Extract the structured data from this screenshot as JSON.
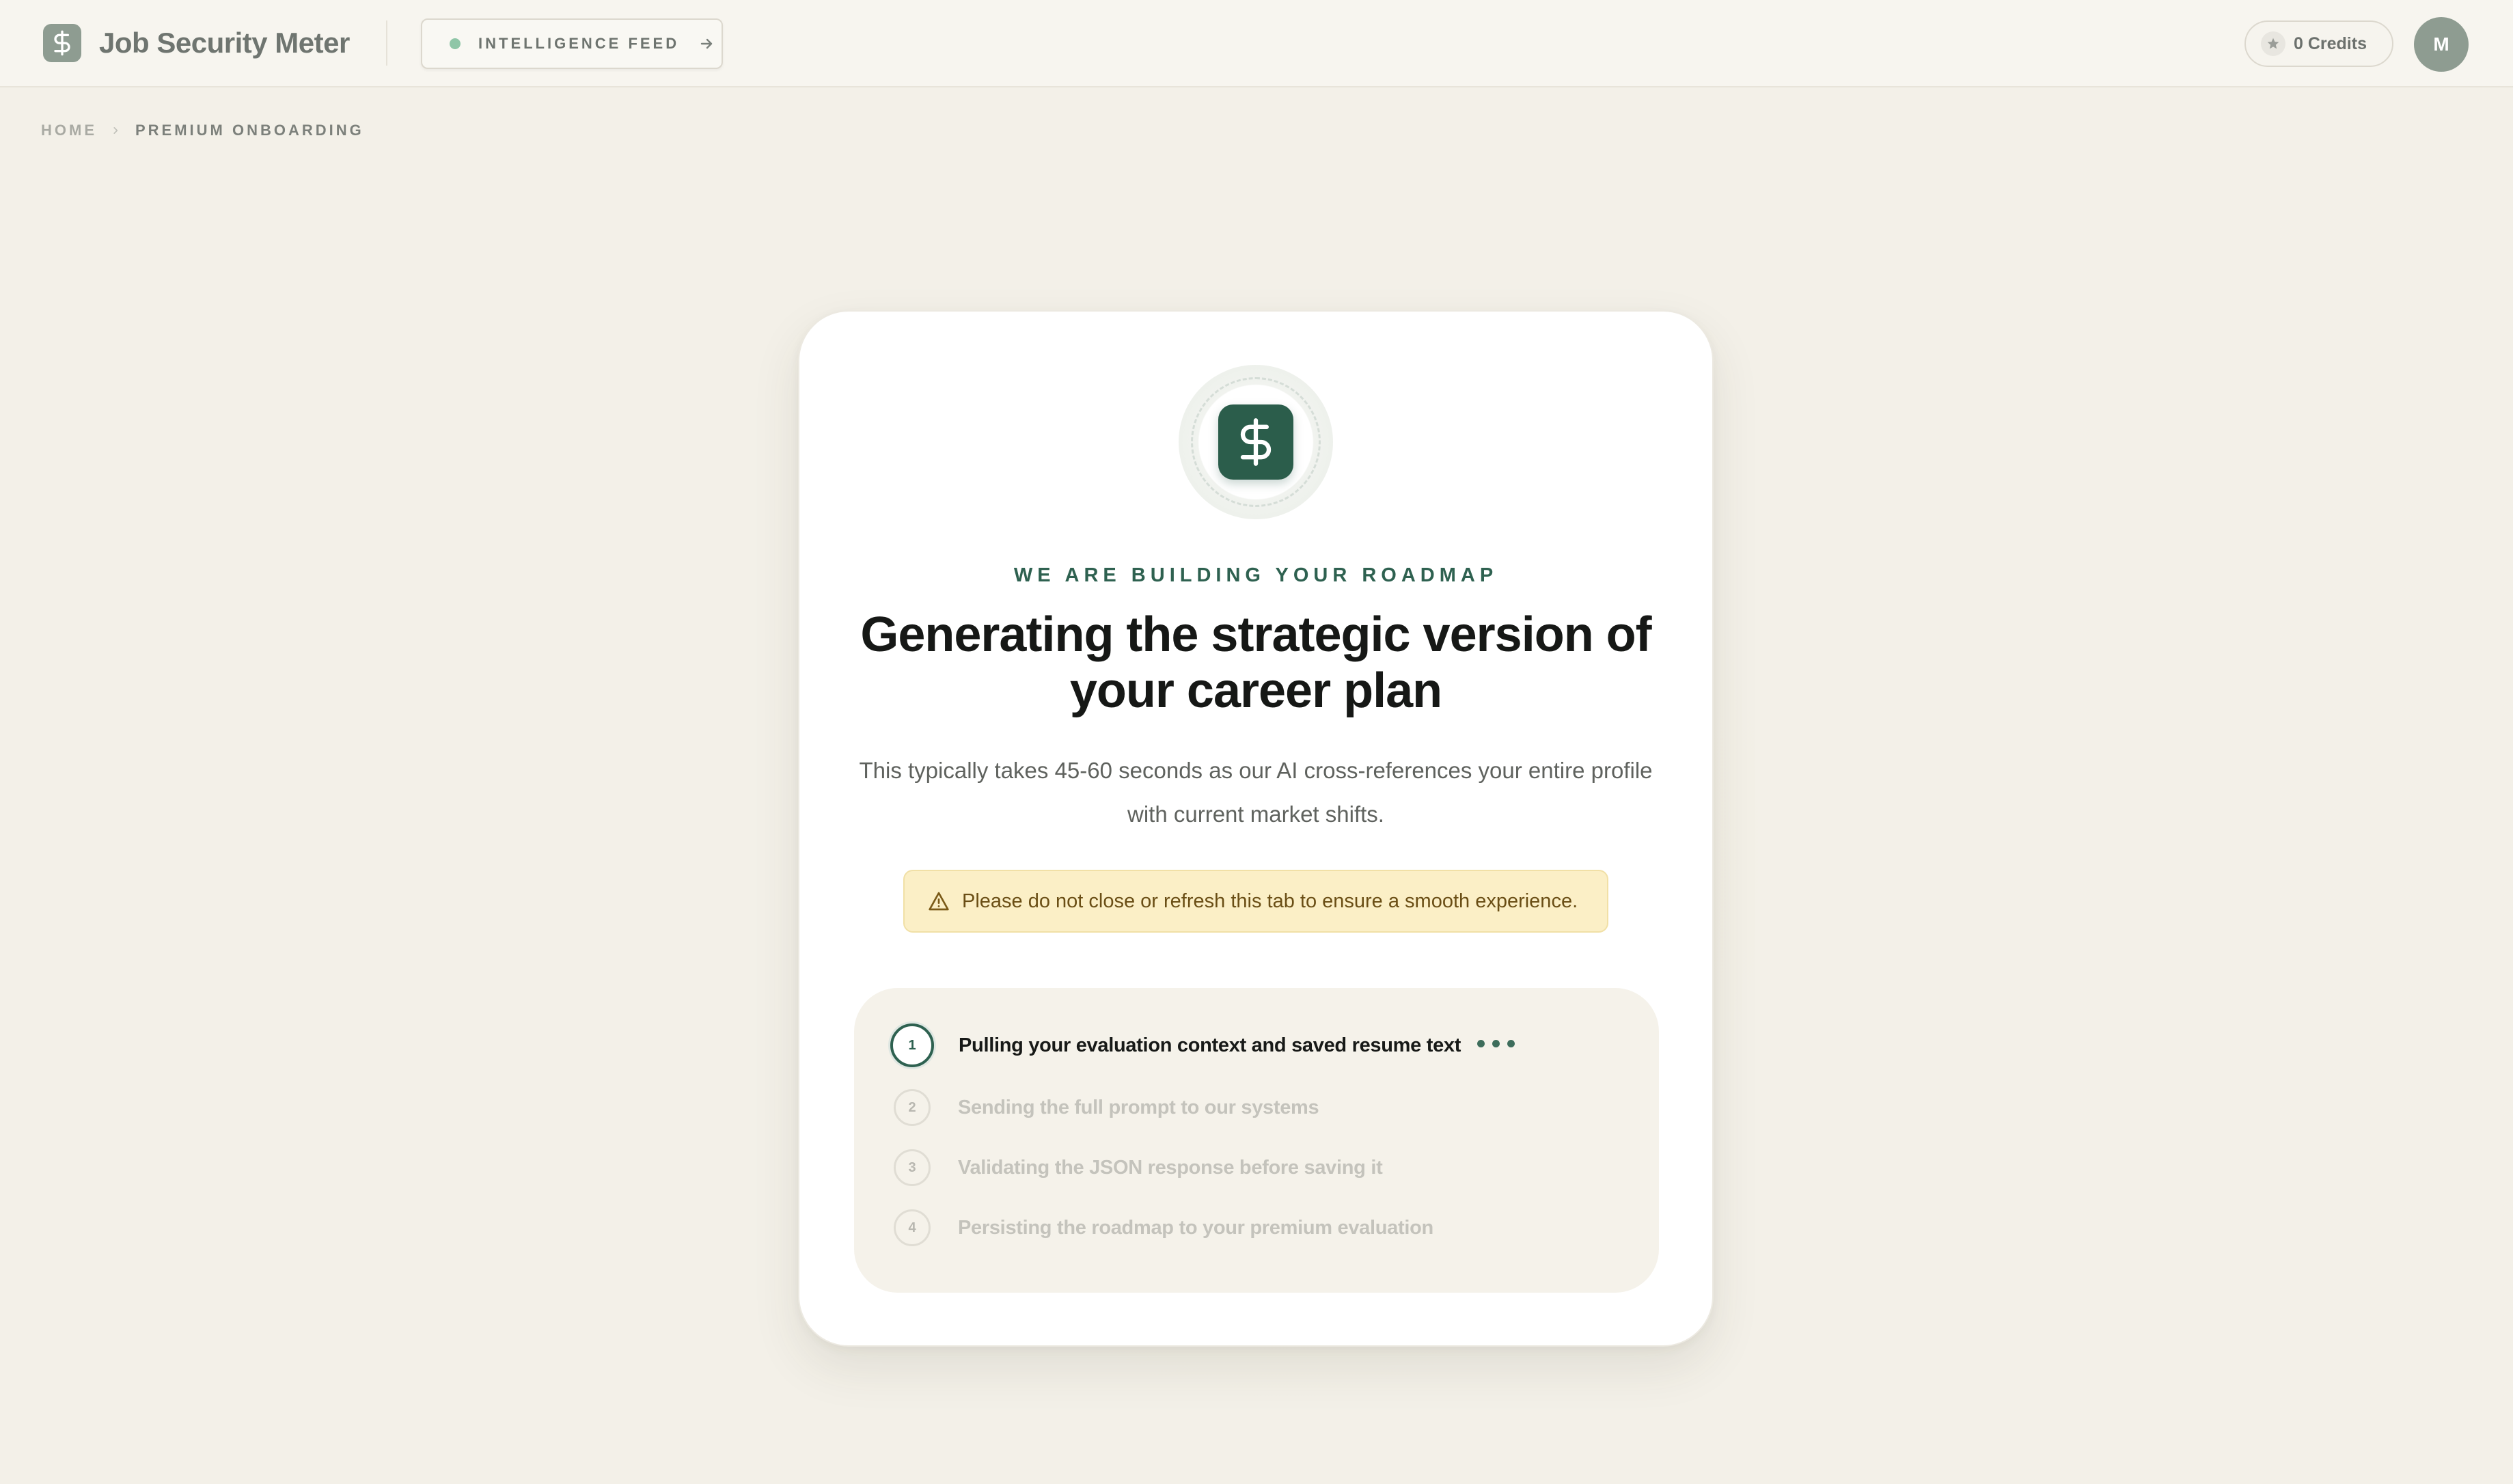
{
  "header": {
    "app_title": "Job Security Meter",
    "logo_icon": "dollar-sign-icon",
    "feed_button_label": "INTELLIGENCE FEED",
    "credits_label": "0 Credits",
    "avatar_initial": "M"
  },
  "breadcrumb": {
    "home": "HOME",
    "current": "PREMIUM ONBOARDING"
  },
  "card": {
    "eyebrow": "WE ARE BUILDING YOUR ROADMAP",
    "title": "Generating the strategic version of your career plan",
    "subtitle": "This typically takes 45-60 seconds as our AI cross-references your entire profile with current market shifts.",
    "warning": "Please do not close or refresh this tab to ensure a smooth experience."
  },
  "steps": [
    {
      "number": "1",
      "label": "Pulling your evaluation context and saved resume text",
      "status": "active"
    },
    {
      "number": "2",
      "label": "Sending the full prompt to our systems",
      "status": "pending"
    },
    {
      "number": "3",
      "label": "Validating the JSON response before saving it",
      "status": "pending"
    },
    {
      "number": "4",
      "label": "Persisting the roadmap to your premium evaluation",
      "status": "pending"
    }
  ],
  "colors": {
    "brand_green": "#2b5d4b",
    "logo_muted": "#8e9c91",
    "background": "#f3f0e8",
    "warning_bg": "#fbefc6",
    "feed_dot": "#8fc6a7"
  }
}
